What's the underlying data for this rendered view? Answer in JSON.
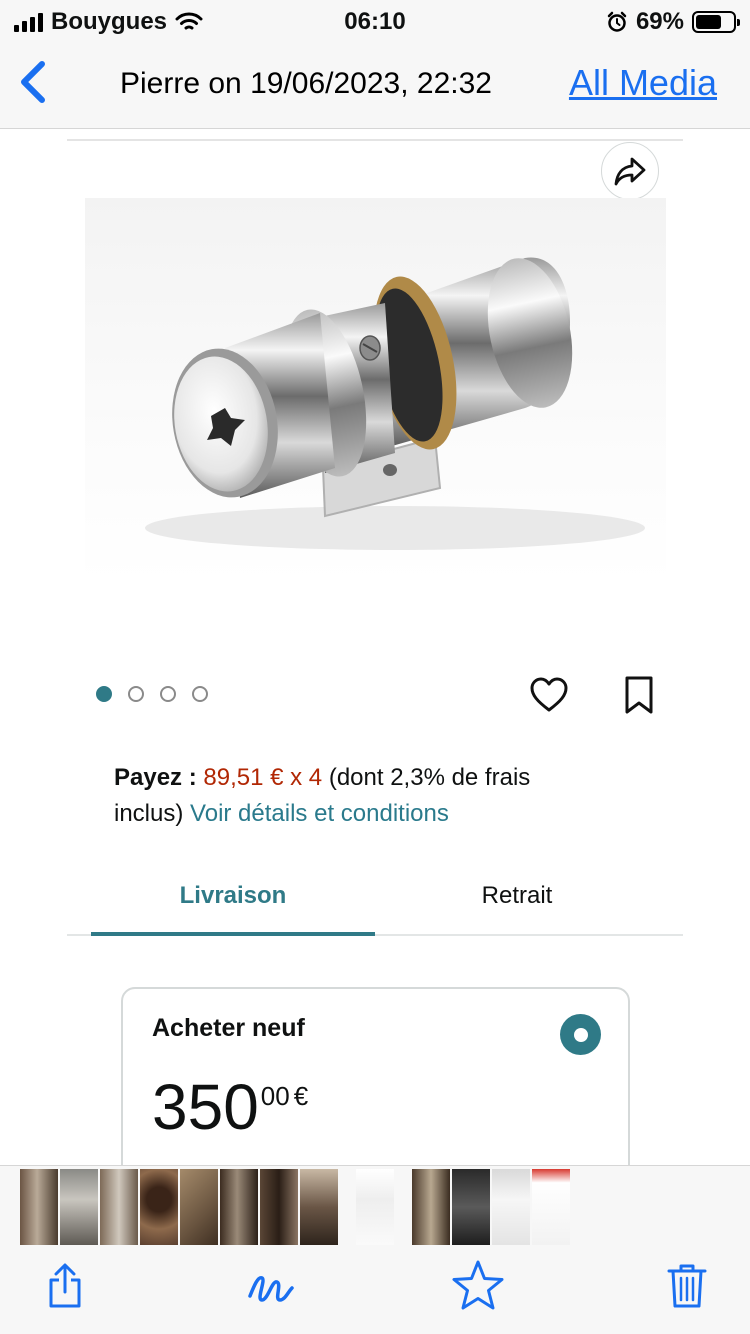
{
  "status_bar": {
    "carrier": "Bouygues",
    "time": "06:10",
    "battery_percent": "69%",
    "battery_level": 0.69
  },
  "nav": {
    "back_icon": "chevron-left-icon",
    "title": "Pierre on 19/06/2023, 22:32",
    "action_label": "All Media"
  },
  "product": {
    "share_icon": "share-arrow-icon",
    "image": "door-lock-cylinder-photo",
    "carousel": {
      "count": 4,
      "active_index": 0
    },
    "favorite_icon": "heart-icon",
    "save_icon": "bookmark-icon"
  },
  "payment": {
    "label": "Payez :",
    "amount": "89,51 € x 4",
    "details": "(dont 2,3% de frais inclus)",
    "link": "Voir détails et conditions"
  },
  "tabs": [
    {
      "label": "Livraison",
      "active": true
    },
    {
      "label": "Retrait",
      "active": false
    }
  ],
  "offer": {
    "title": "Acheter neuf",
    "price_whole": "350",
    "price_fraction": "00",
    "currency": "€",
    "selected": true
  },
  "toolbar": {
    "share_icon": "share-icon",
    "markup_icon": "markup-pen-icon",
    "favorite_icon": "star-icon",
    "delete_icon": "trash-icon"
  },
  "colors": {
    "accent_teal": "#2f7a87",
    "ios_blue": "#1a6ff0",
    "price_red": "#b12704"
  }
}
